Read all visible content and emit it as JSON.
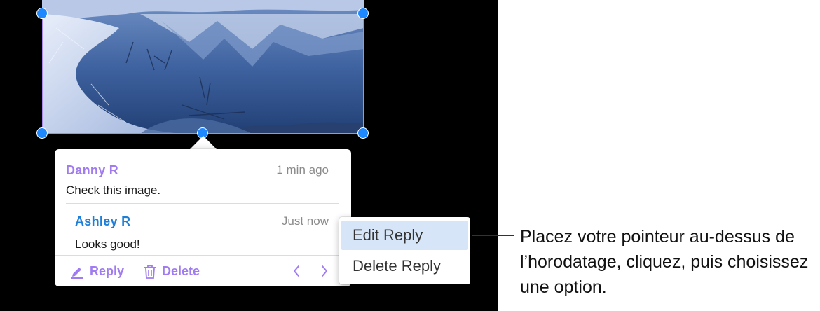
{
  "colors": {
    "accent_purple": "#a07cf0",
    "reply_author_blue": "#1e7fd8",
    "handle_blue": "#1e88ff",
    "menu_highlight": "#d6e6f8"
  },
  "comment_thread": {
    "comments": [
      {
        "author": "Danny R",
        "time": "1 min ago",
        "text": "Check this image."
      },
      {
        "author": "Ashley R",
        "time": "Just now",
        "text": "Looks good!"
      }
    ],
    "toolbar": {
      "reply_label": "Reply",
      "reply_icon": "pencil-icon",
      "delete_label": "Delete",
      "delete_icon": "trash-icon",
      "prev_icon": "chevron-left-icon",
      "next_icon": "chevron-right-icon"
    }
  },
  "context_menu": {
    "items": [
      {
        "label": "Edit Reply",
        "highlighted": true
      },
      {
        "label": "Delete Reply",
        "highlighted": false
      }
    ]
  },
  "callout": {
    "text": "Placez votre pointeur au-dessus de l’horodatage, cliquez, puis choisissez une option."
  }
}
